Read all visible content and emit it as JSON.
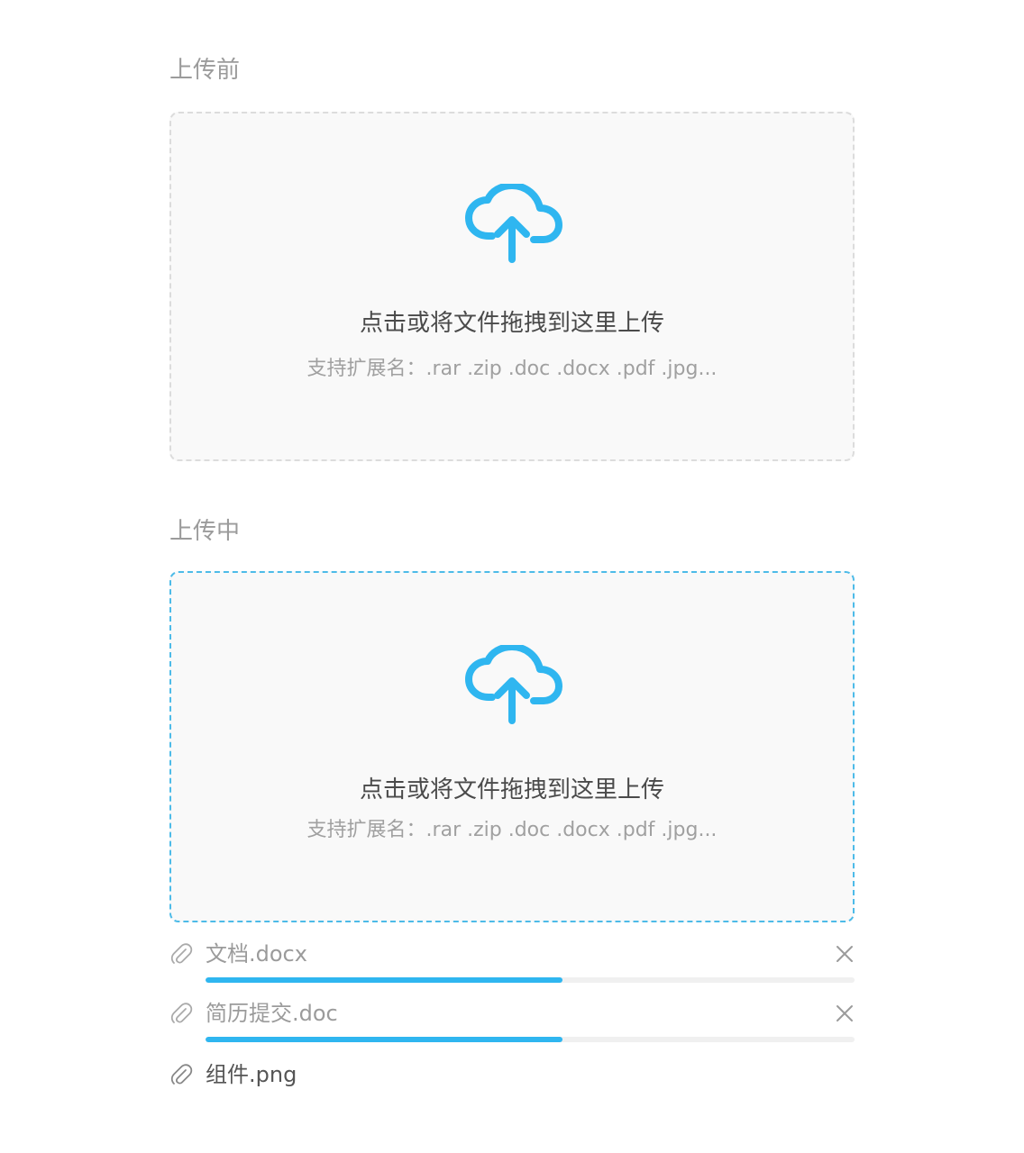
{
  "sections": {
    "before_title": "上传前",
    "during_title": "上传中"
  },
  "dropzone": {
    "main_text": "点击或将文件拖拽到这里上传",
    "hint_text": "支持扩展名：.rar .zip .doc .docx .pdf .jpg...",
    "icon": "cloud-upload-icon",
    "accent_color": "#2fb6f0",
    "idle_border_color": "#dcdcdc",
    "active_border_color": "#4dbbe8"
  },
  "files": [
    {
      "name": "文档.docx",
      "status": "uploading",
      "progress": 0.55,
      "icon": "paperclip-icon"
    },
    {
      "name": "简历提交.doc",
      "status": "uploading",
      "progress": 0.55,
      "icon": "paperclip-icon"
    },
    {
      "name": "组件.png",
      "status": "done",
      "icon": "paperclip-icon"
    }
  ]
}
